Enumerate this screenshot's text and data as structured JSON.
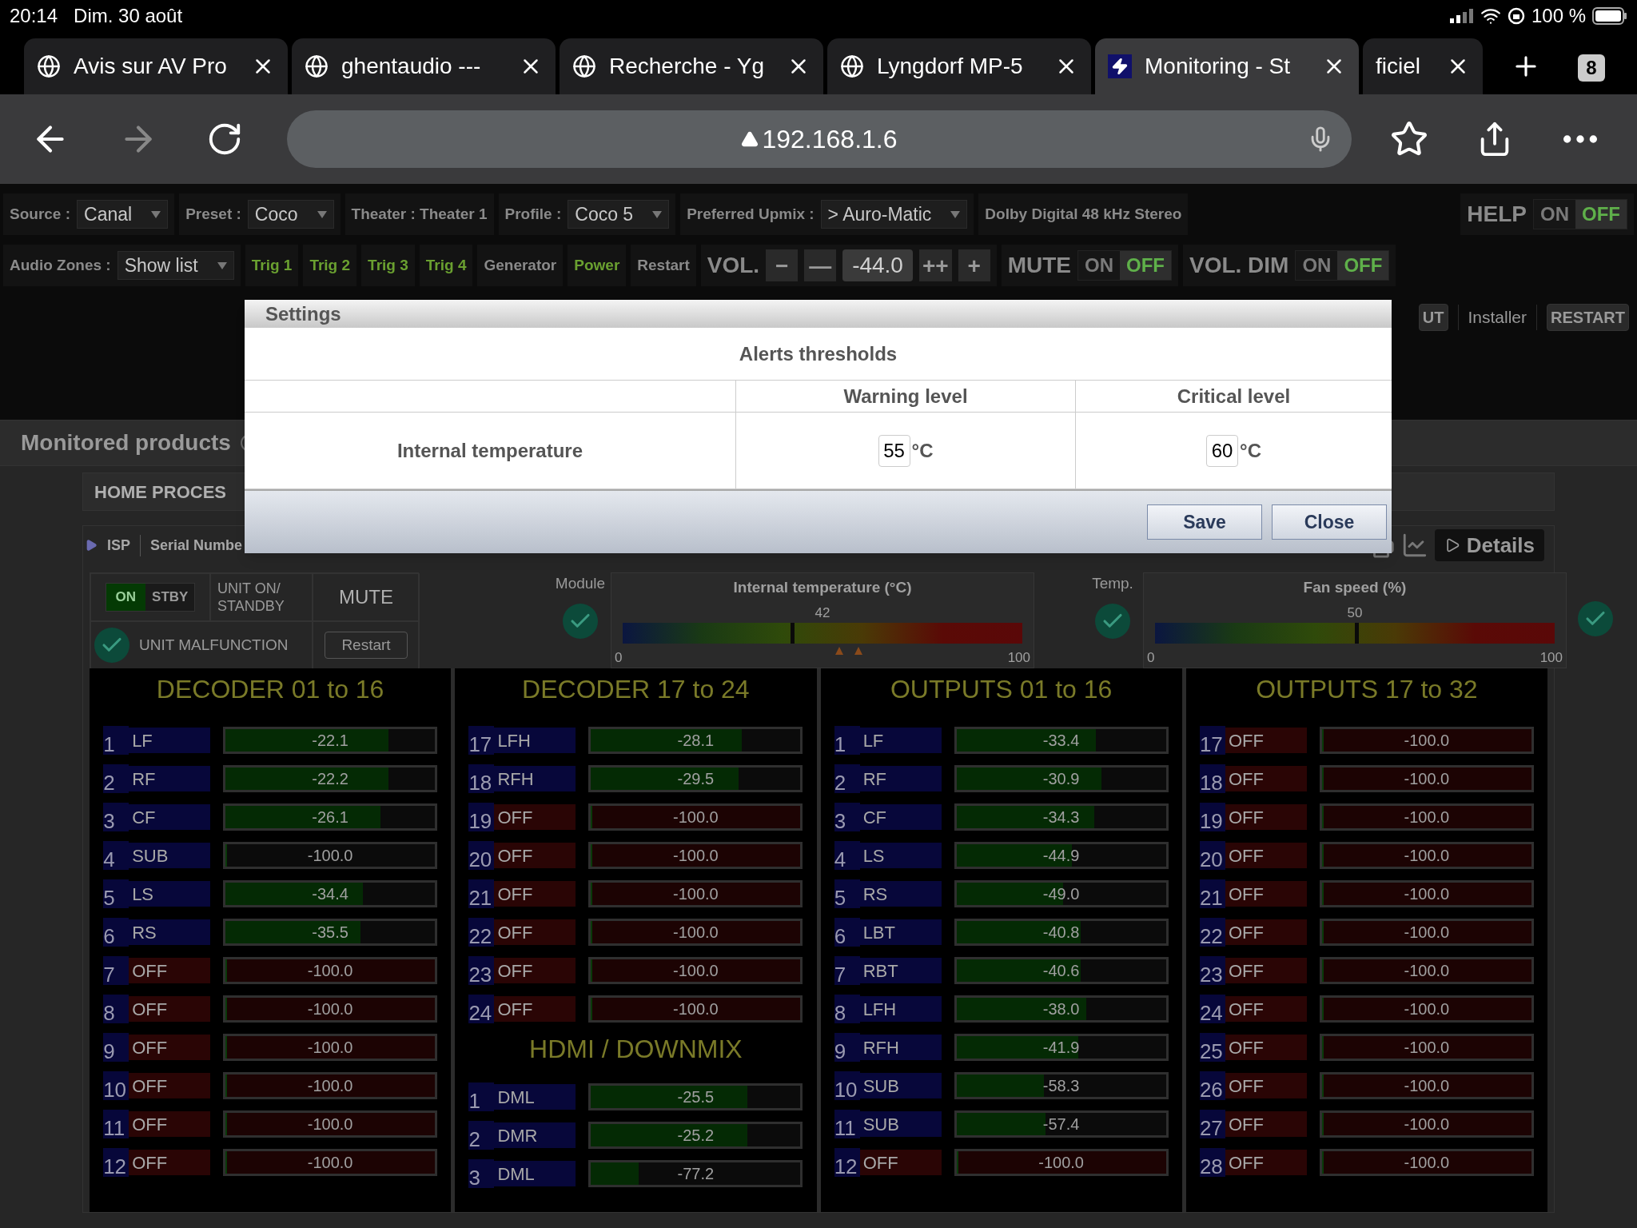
{
  "status_bar": {
    "time": "20:14",
    "date": "Dim. 30 août",
    "battery": "100 %"
  },
  "tabs": [
    {
      "label": "Avis sur AV Pro",
      "kind": "web",
      "selected": false
    },
    {
      "label": "ghentaudio ---",
      "kind": "web",
      "selected": false
    },
    {
      "label": "Recherche - Yg",
      "kind": "web",
      "selected": false
    },
    {
      "label": "Lyngdorf MP-5",
      "kind": "web",
      "selected": false
    },
    {
      "label": "Monitoring - St",
      "kind": "app",
      "selected": true
    },
    {
      "label": "ficiel",
      "kind": "partial",
      "selected": false
    }
  ],
  "tab_count": "8",
  "address_bar": {
    "url": "192.168.1.6"
  },
  "controls": {
    "row_1": [
      {
        "kind": "select",
        "label": "Source :",
        "value": "Canal"
      },
      {
        "kind": "select",
        "label": "Preset :",
        "value": "Coco"
      },
      {
        "kind": "text",
        "text": "Theater : Theater 1"
      },
      {
        "kind": "select",
        "label": "Profile :",
        "value": "Coco 5"
      },
      {
        "kind": "select",
        "label": "Preferred Upmix :",
        "value": "> Auro-Matic"
      },
      {
        "kind": "text",
        "text": "Dolby Digital 48 kHz Stereo"
      },
      {
        "kind": "toggle",
        "label": "HELP",
        "on_label": "ON",
        "off_label": "OFF",
        "on": false
      }
    ],
    "row_2": [
      {
        "kind": "select",
        "label": "Audio Zones :",
        "value": "Show list"
      },
      {
        "kind": "button",
        "label": "Trig 1",
        "active": true
      },
      {
        "kind": "button",
        "label": "Trig 2",
        "active": true
      },
      {
        "kind": "button",
        "label": "Trig 3",
        "active": true
      },
      {
        "kind": "button",
        "label": "Trig 4",
        "active": true
      },
      {
        "kind": "button",
        "label": "Generator",
        "active": false
      },
      {
        "kind": "button",
        "label": "Power",
        "active": true
      },
      {
        "kind": "button",
        "label": "Restart",
        "active": false
      },
      {
        "kind": "volume",
        "label": "VOL.",
        "value": "-44.0",
        "buttons_before": [
          "−",
          "—"
        ],
        "buttons_after": [
          "++",
          "+"
        ]
      },
      {
        "kind": "toggle",
        "label": "MUTE",
        "on_label": "ON",
        "off_label": "OFF",
        "on": false
      },
      {
        "kind": "toggle",
        "label": "VOL. DIM",
        "on_label": "ON",
        "off_label": "OFF",
        "on": false
      }
    ],
    "row_3": [
      {
        "kind": "button",
        "label": "UT"
      },
      {
        "kind": "link",
        "label": "Installer"
      },
      {
        "kind": "button",
        "label": "RESTART"
      }
    ]
  },
  "monitored": {
    "title": "Monitored products",
    "product": "HOME PROCES",
    "info": [
      "ISP",
      "Serial Numbe"
    ],
    "details_button": "Details"
  },
  "unit": {
    "power_toggle": {
      "on_label": "ON",
      "off_label": "STBY",
      "on": true
    },
    "power_label": "UNIT ON/ STANDBY",
    "mute_button": "MUTE",
    "malfunction_label": "UNIT MALFUNCTION",
    "restart_button": "Restart"
  },
  "gauges": [
    {
      "side_label": "Module",
      "title": "Internal temperature (°C)",
      "value": "42",
      "level": 0.42,
      "min": "0",
      "max": "100",
      "warnings": true
    },
    {
      "side_label": "Temp.",
      "title": "Fan speed (%)",
      "value": "50",
      "level": 0.5,
      "min": "0",
      "max": "100",
      "warnings": false
    }
  ],
  "panels": [
    {
      "title": "DECODER 01 to 16",
      "groups": [
        {
          "channels": [
            {
              "number": "1",
              "name": "LF",
              "active": true,
              "level": 0.779,
              "reading": "-22.1"
            },
            {
              "number": "2",
              "name": "RF",
              "active": true,
              "level": 0.778,
              "reading": "-22.2"
            },
            {
              "number": "3",
              "name": "CF",
              "active": true,
              "level": 0.739,
              "reading": "-26.1"
            },
            {
              "number": "4",
              "name": "SUB",
              "active": true,
              "level": 0,
              "reading": "-100.0"
            },
            {
              "number": "5",
              "name": "LS",
              "active": true,
              "level": 0.656,
              "reading": "-34.4"
            },
            {
              "number": "6",
              "name": "RS",
              "active": true,
              "level": 0.645,
              "reading": "-35.5"
            },
            {
              "number": "7",
              "name": "OFF",
              "active": false,
              "level": 0,
              "reading": "-100.0"
            },
            {
              "number": "8",
              "name": "OFF",
              "active": false,
              "level": 0,
              "reading": "-100.0"
            },
            {
              "number": "9",
              "name": "OFF",
              "active": false,
              "level": 0,
              "reading": "-100.0"
            },
            {
              "number": "10",
              "name": "OFF",
              "active": false,
              "level": 0,
              "reading": "-100.0"
            },
            {
              "number": "11",
              "name": "OFF",
              "active": false,
              "level": 0,
              "reading": "-100.0"
            },
            {
              "number": "12",
              "name": "OFF",
              "active": false,
              "level": 0,
              "reading": "-100.0"
            }
          ]
        }
      ]
    },
    {
      "title": "DECODER 17 to 24",
      "groups": [
        {
          "channels": [
            {
              "number": "17",
              "name": "LFH",
              "active": true,
              "level": 0.719,
              "reading": "-28.1"
            },
            {
              "number": "18",
              "name": "RFH",
              "active": true,
              "level": 0.705,
              "reading": "-29.5"
            },
            {
              "number": "19",
              "name": "OFF",
              "active": false,
              "level": 0,
              "reading": "-100.0"
            },
            {
              "number": "20",
              "name": "OFF",
              "active": false,
              "level": 0,
              "reading": "-100.0"
            },
            {
              "number": "21",
              "name": "OFF",
              "active": false,
              "level": 0,
              "reading": "-100.0"
            },
            {
              "number": "22",
              "name": "OFF",
              "active": false,
              "level": 0,
              "reading": "-100.0"
            },
            {
              "number": "23",
              "name": "OFF",
              "active": false,
              "level": 0,
              "reading": "-100.0"
            },
            {
              "number": "24",
              "name": "OFF",
              "active": false,
              "level": 0,
              "reading": "-100.0"
            }
          ]
        },
        {
          "title": "HDMI / DOWNMIX",
          "channels": [
            {
              "number": "1",
              "name": "DML",
              "active": true,
              "level": 0.745,
              "reading": "-25.5"
            },
            {
              "number": "2",
              "name": "DMR",
              "active": true,
              "level": 0.748,
              "reading": "-25.2"
            },
            {
              "number": "3",
              "name": "DML",
              "active": true,
              "level": 0.228,
              "reading": "-77.2"
            }
          ]
        }
      ]
    },
    {
      "title": "OUTPUTS 01 to 16",
      "groups": [
        {
          "channels": [
            {
              "number": "1",
              "name": "LF",
              "active": true,
              "level": 0.666,
              "reading": "-33.4"
            },
            {
              "number": "2",
              "name": "RF",
              "active": true,
              "level": 0.691,
              "reading": "-30.9"
            },
            {
              "number": "3",
              "name": "CF",
              "active": true,
              "level": 0.657,
              "reading": "-34.3"
            },
            {
              "number": "4",
              "name": "LS",
              "active": true,
              "level": 0.551,
              "reading": "-44.9"
            },
            {
              "number": "5",
              "name": "RS",
              "active": true,
              "level": 0.51,
              "reading": "-49.0"
            },
            {
              "number": "6",
              "name": "LBT",
              "active": true,
              "level": 0.592,
              "reading": "-40.8"
            },
            {
              "number": "7",
              "name": "RBT",
              "active": true,
              "level": 0.594,
              "reading": "-40.6"
            },
            {
              "number": "8",
              "name": "LFH",
              "active": true,
              "level": 0.62,
              "reading": "-38.0"
            },
            {
              "number": "9",
              "name": "RFH",
              "active": true,
              "level": 0.581,
              "reading": "-41.9"
            },
            {
              "number": "10",
              "name": "SUB",
              "active": true,
              "level": 0.417,
              "reading": "-58.3"
            },
            {
              "number": "11",
              "name": "SUB",
              "active": true,
              "level": 0.426,
              "reading": "-57.4"
            },
            {
              "number": "12",
              "name": "OFF",
              "active": false,
              "level": 0,
              "reading": "-100.0"
            }
          ]
        }
      ]
    },
    {
      "title": "OUTPUTS 17 to 32",
      "groups": [
        {
          "channels": [
            {
              "number": "17",
              "name": "OFF",
              "active": false,
              "level": 0,
              "reading": "-100.0"
            },
            {
              "number": "18",
              "name": "OFF",
              "active": false,
              "level": 0,
              "reading": "-100.0"
            },
            {
              "number": "19",
              "name": "OFF",
              "active": false,
              "level": 0,
              "reading": "-100.0"
            },
            {
              "number": "20",
              "name": "OFF",
              "active": false,
              "level": 0,
              "reading": "-100.0"
            },
            {
              "number": "21",
              "name": "OFF",
              "active": false,
              "level": 0,
              "reading": "-100.0"
            },
            {
              "number": "22",
              "name": "OFF",
              "active": false,
              "level": 0,
              "reading": "-100.0"
            },
            {
              "number": "23",
              "name": "OFF",
              "active": false,
              "level": 0,
              "reading": "-100.0"
            },
            {
              "number": "24",
              "name": "OFF",
              "active": false,
              "level": 0,
              "reading": "-100.0"
            },
            {
              "number": "25",
              "name": "OFF",
              "active": false,
              "level": 0,
              "reading": "-100.0"
            },
            {
              "number": "26",
              "name": "OFF",
              "active": false,
              "level": 0,
              "reading": "-100.0"
            },
            {
              "number": "27",
              "name": "OFF",
              "active": false,
              "level": 0,
              "reading": "-100.0"
            },
            {
              "number": "28",
              "name": "OFF",
              "active": false,
              "level": 0,
              "reading": "-100.0"
            }
          ]
        }
      ]
    }
  ],
  "dialog": {
    "title": "Settings",
    "heading": "Alerts thresholds",
    "columns": [
      "Warning level",
      "Critical level"
    ],
    "rows": [
      {
        "label": "Internal temperature",
        "values": [
          {
            "value": "55",
            "unit": "°C"
          },
          {
            "value": "60",
            "unit": "°C"
          }
        ]
      }
    ],
    "buttons": [
      "Save",
      "Close"
    ]
  }
}
